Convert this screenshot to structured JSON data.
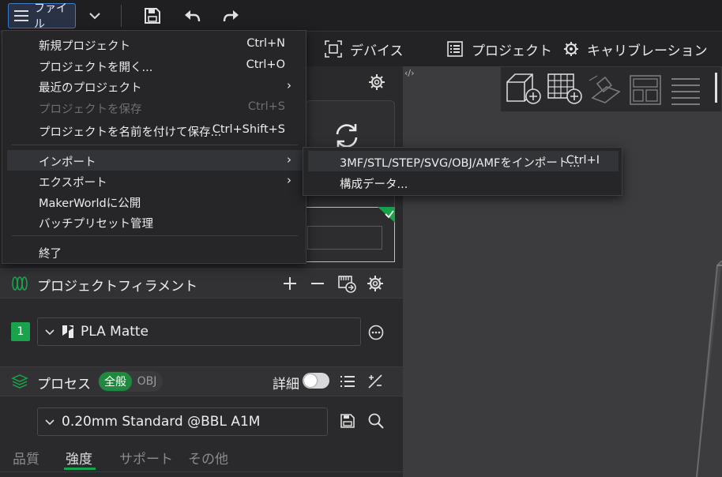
{
  "titlebar": {
    "file_label": "ファイル"
  },
  "tabs": [
    {
      "label": "デバイス"
    },
    {
      "label": "プロジェクト"
    },
    {
      "label": "キャリブレーション"
    }
  ],
  "file_menu": {
    "items": [
      {
        "label": "新規プロジェクト",
        "shortcut": "Ctrl+N"
      },
      {
        "label": "プロジェクトを開く...",
        "shortcut": "Ctrl+O"
      },
      {
        "label": "最近のプロジェクト",
        "shortcut": ""
      },
      {
        "label": "プロジェクトを保存",
        "shortcut": "Ctrl+S"
      },
      {
        "label": "プロジェクトを名前を付けて保存...",
        "shortcut": "Ctrl+Shift+S"
      },
      {
        "label": "インポート",
        "shortcut": ""
      },
      {
        "label": "エクスポート",
        "shortcut": ""
      },
      {
        "label": "MakerWorldに公開",
        "shortcut": ""
      },
      {
        "label": "バッチプリセット管理",
        "shortcut": ""
      },
      {
        "label": "終了",
        "shortcut": ""
      }
    ],
    "submenu_arrow": "›"
  },
  "import_submenu": {
    "items": [
      {
        "label": "3MF/STL/STEP/SVG/OBJ/AMFをインポート...",
        "shortcut": "Ctrl+I"
      },
      {
        "label": "構成データ...",
        "shortcut": ""
      }
    ]
  },
  "filament": {
    "section_title": "プロジェクトフィラメント",
    "slot_number": "1",
    "name": "PLA Matte"
  },
  "process": {
    "section_title": "プロセス",
    "toggle_on": "全般",
    "toggle_off": "OBJ",
    "detail_label": "詳細",
    "preset": "0.20mm Standard @BBL A1M"
  },
  "subtabs": [
    {
      "label": "品質"
    },
    {
      "label": "強度"
    },
    {
      "label": "サポート"
    },
    {
      "label": "その他"
    }
  ],
  "viewport": {
    "toggle": "‹/›"
  },
  "colors": {
    "accent": "#1aa34a",
    "highlight": "#3f7ad6"
  }
}
